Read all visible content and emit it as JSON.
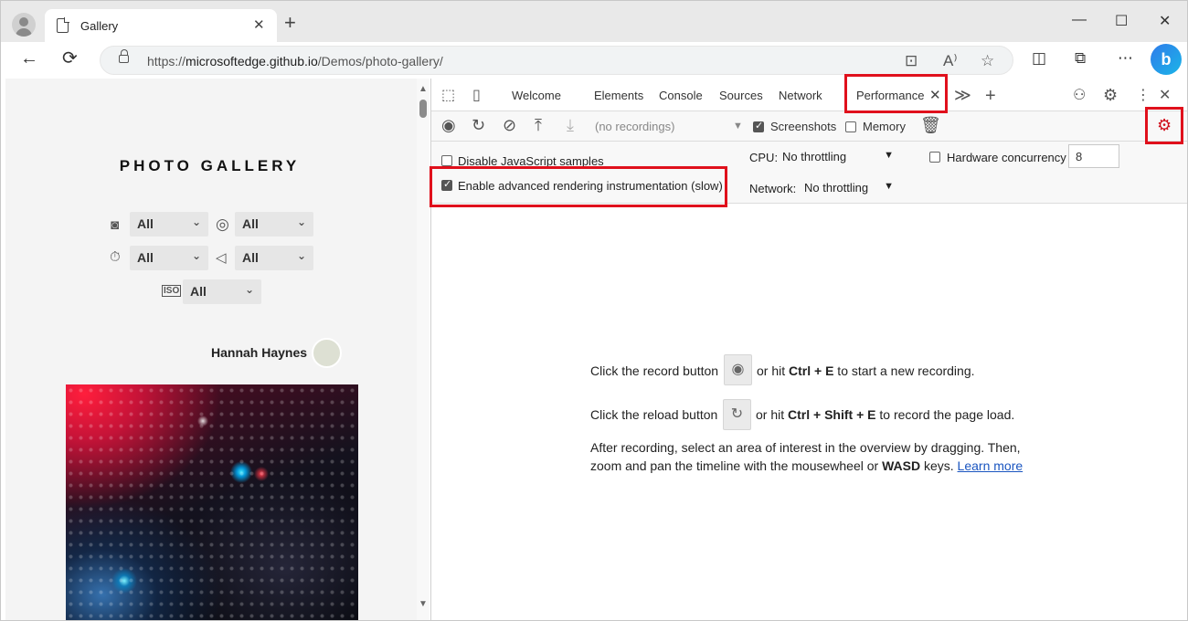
{
  "browser": {
    "tab_title": "Gallery",
    "tab_close": "✕",
    "new_tab": "+",
    "url_prefix": "https://",
    "url_host": "microsoftedge.github.io",
    "url_path": "/Demos/photo-gallery/",
    "window_controls": {
      "minimize": "—",
      "maximize": "☐",
      "close": "✕"
    },
    "nav": {
      "back": "←",
      "refresh": "⟳"
    },
    "bing_letter": "b"
  },
  "page": {
    "title": "PHOTO GALLERY",
    "filters": [
      {
        "icon": "camera-icon",
        "glyph": "📷",
        "value": "All"
      },
      {
        "icon": "aperture-icon",
        "glyph": "◎",
        "value": "All"
      },
      {
        "icon": "timer-icon",
        "glyph": "⏱",
        "value": "All"
      },
      {
        "icon": "speaker-icon",
        "glyph": "◁",
        "value": "All"
      },
      {
        "icon": "iso-icon",
        "glyph": "ISO",
        "value": "All"
      }
    ],
    "caret": "⌄",
    "author": "Hannah Haynes"
  },
  "devtools": {
    "tabs": [
      "Welcome",
      "Elements",
      "Console",
      "Sources",
      "Network"
    ],
    "active_tab": "Performance",
    "active_close": "✕",
    "more_tabs": "≫",
    "add_tab": "+",
    "toolbar": {
      "recordings": "(no recordings)",
      "screenshots_label": "Screenshots",
      "screenshots_checked": true,
      "memory_label": "Memory",
      "memory_checked": false
    },
    "settings": {
      "disable_js_label": "Disable JavaScript samples",
      "disable_js_checked": false,
      "advanced_rendering_label": "Enable advanced rendering instrumentation (slow)",
      "advanced_rendering_checked": true,
      "cpu_label": "CPU:",
      "cpu_value": "No throttling",
      "network_label": "Network:",
      "network_value": "No throttling",
      "hw_label": "Hardware concurrency",
      "hw_value": "8",
      "hw_checked": false
    },
    "landing": {
      "record_pre": "Click the record button",
      "record_post_1": "or hit ",
      "record_keys": "Ctrl + E",
      "record_post_2": " to start a new recording.",
      "reload_pre": "Click the reload button",
      "reload_post_1": "or hit ",
      "reload_keys": "Ctrl + Shift + E",
      "reload_post_2": " to record the page load.",
      "after_1": "After recording, select an area of interest in the overview by dragging. Then,",
      "after_2a": "zoom and pan the timeline with the mousewheel or ",
      "after_2_keys": "WASD",
      "after_2b": " keys. ",
      "learn_more": "Learn more"
    }
  },
  "colors": {
    "highlight": "#e0101c",
    "link": "#1a55c0"
  }
}
